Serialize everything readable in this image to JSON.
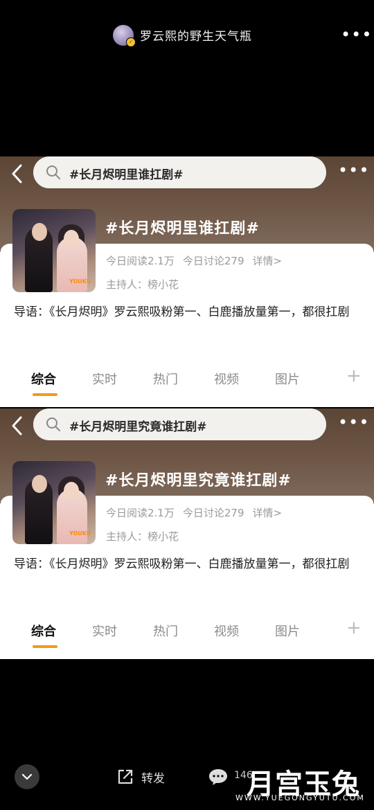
{
  "header": {
    "username": "罗云熙的野生天气瓶"
  },
  "cards": [
    {
      "search_text": "#长月烬明里谁扛剧#",
      "title": "#长月烬明里谁扛剧#",
      "read": "今日阅读2.1万",
      "discuss": "今日讨论279",
      "detail": "详情>",
      "host": "主持人：榜小花",
      "intro": "导语：《长月烬明》罗云熙吸粉第一、白鹿播放量第一，都很扛剧",
      "tabs": [
        "综合",
        "实时",
        "热门",
        "视频",
        "图片"
      ]
    },
    {
      "search_text": "#长月烬明里究竟谁扛剧#",
      "title": "#长月烬明里究竟谁扛剧#",
      "read": "今日阅读2.1万",
      "discuss": "今日讨论279",
      "detail": "详情>",
      "host": "主持人：榜小花",
      "intro": "导语：《长月烬明》罗云熙吸粉第一、白鹿播放量第一，都很扛剧",
      "tabs": [
        "综合",
        "实时",
        "热门",
        "视频",
        "图片"
      ]
    }
  ],
  "bottom": {
    "share_label": "转发",
    "comment_count": "146",
    "watermark": "月宫玉兔",
    "watermark_url": "WWW.YUEGONGYUTU.COM"
  },
  "colors": {
    "accent": "#f19a1a",
    "card_header": "#6f5747"
  }
}
